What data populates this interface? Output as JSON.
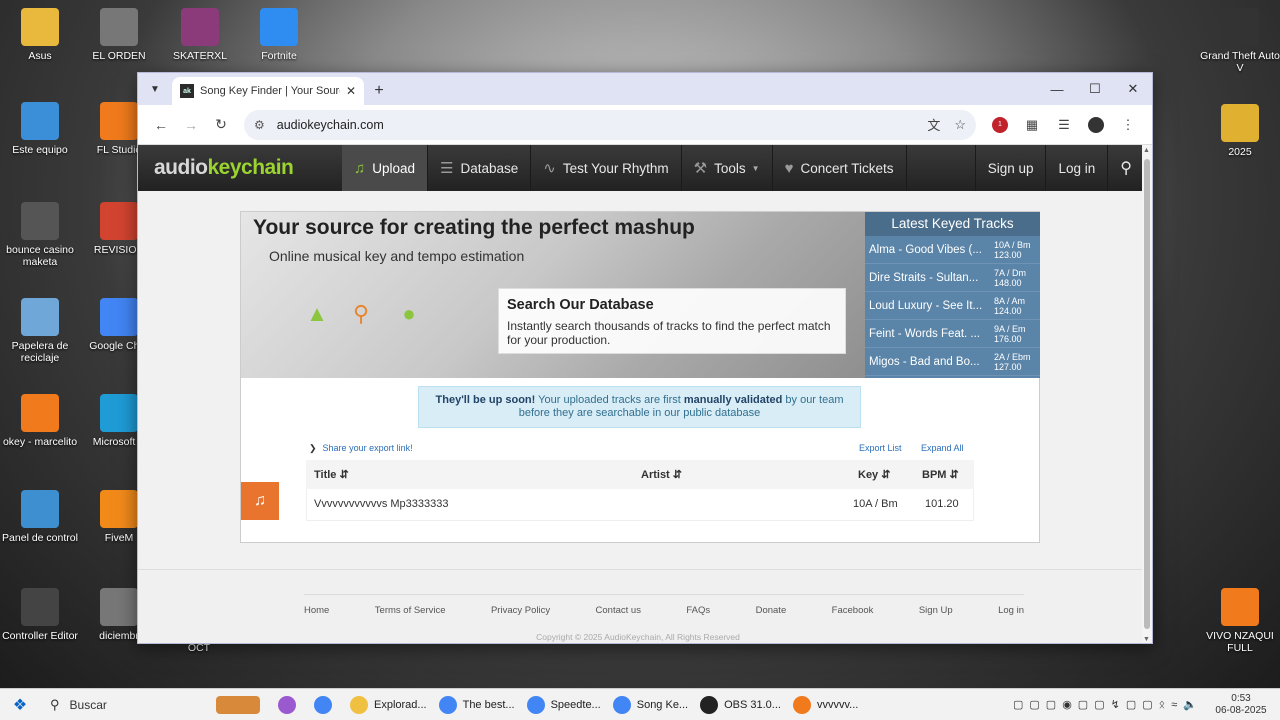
{
  "desktop_left": [
    {
      "label": "Asus",
      "icon": "folder-user-icon",
      "color": "#e8b93c"
    },
    {
      "label": "EL ORDEN",
      "icon": "file-icon",
      "color": "#777777"
    },
    {
      "label": "SKATERXL",
      "icon": "winrar-icon",
      "color": "#8b3a7a"
    },
    {
      "label": "Fortnite",
      "icon": "fortnite-icon",
      "color": "#2f8cf0"
    },
    {
      "label": "Este equipo",
      "icon": "computer-icon",
      "color": "#3b8fd8"
    },
    {
      "label": "FL Studio",
      "icon": "fl-studio-icon",
      "color": "#f07a1c"
    },
    {
      "label": "bounce casino maketa",
      "icon": "video-file-icon",
      "color": "#555555"
    },
    {
      "label": "REVISION",
      "icon": "pdf-icon",
      "color": "#d24430"
    },
    {
      "label": "Papelera de reciclaje",
      "icon": "recycle-bin-icon",
      "color": "#6fa8d8"
    },
    {
      "label": "Google Chro",
      "icon": "chrome-icon",
      "color": "#4285f4"
    },
    {
      "label": "okey - marcelito",
      "icon": "fl-studio-icon",
      "color": "#f07a1c"
    },
    {
      "label": "Microsoft E",
      "icon": "edge-icon",
      "color": "#1f9bd6"
    },
    {
      "label": "Panel de control",
      "icon": "control-panel-icon",
      "color": "#3d8fd0"
    },
    {
      "label": "FiveM",
      "icon": "fivem-icon",
      "color": "#f28a1a"
    },
    {
      "label": "Controller Editor",
      "icon": "controller-icon",
      "color": "#444444"
    },
    {
      "label": "diciembr",
      "icon": "file-icon",
      "color": "#777777"
    },
    {
      "label": "OCT",
      "icon": "",
      "color": ""
    }
  ],
  "desktop_right": [
    {
      "label": "Grand Theft Auto V",
      "icon": "gta-icon",
      "color": "#333333"
    },
    {
      "label": "2025",
      "icon": "file-icon",
      "color": "#e0b030"
    },
    {
      "label": "VIVO NZAQUI FULL",
      "icon": "fl-studio-icon",
      "color": "#f07a1c"
    }
  ],
  "browser": {
    "tab_title": "Song Key Finder | Your Source f",
    "tab_favicon": "ak",
    "url": "audiokeychain.com",
    "ext_badge": "1"
  },
  "site": {
    "logo_a": "audio",
    "logo_b": "keychain",
    "nav": [
      {
        "label": "Upload",
        "icon": "music-note-icon",
        "active": true
      },
      {
        "label": "Database",
        "icon": "database-icon",
        "active": false
      },
      {
        "label": "Test Your Rhythm",
        "icon": "waveform-icon",
        "active": false
      },
      {
        "label": "Tools",
        "icon": "wrench-icon",
        "active": false
      },
      {
        "label": "Concert Tickets",
        "icon": "ticket-icon",
        "active": false
      }
    ],
    "signup": "Sign up",
    "login": "Log in"
  },
  "hero": {
    "title": "Your source for creating the perfect mashup",
    "subtitle": "Online musical key and tempo estimation",
    "search_title": "Search Our Database",
    "search_desc": "Instantly search thousands of tracks to find the perfect match for your production."
  },
  "latest": {
    "heading": "Latest Keyed Tracks",
    "tracks": [
      {
        "name": "Alma - Good Vibes (...",
        "key": "10A / Bm",
        "bpm": "123.00"
      },
      {
        "name": "Dire Straits - Sultan...",
        "key": "7A / Dm",
        "bpm": "148.00"
      },
      {
        "name": "Loud Luxury - See It...",
        "key": "8A / Am",
        "bpm": "124.00"
      },
      {
        "name": "Feint - Words Feat. ...",
        "key": "9A / Em",
        "bpm": "176.00"
      },
      {
        "name": "Migos - Bad and Bo...",
        "key": "2A / Ebm",
        "bpm": "127.00"
      }
    ]
  },
  "notice": {
    "bold1": "They'll be up soon!",
    "text1": " Your uploaded tracks are first ",
    "bold2": "manually validated",
    "text2": " by our team before they are searchable in our public database"
  },
  "table": {
    "share": "Share your export link!",
    "export": "Export List",
    "expand": "Expand All",
    "headers": {
      "title": "Title",
      "artist": "Artist",
      "key": "Key",
      "bpm": "BPM"
    },
    "rows": [
      {
        "title": "Vvvvvvvvvvvvs Mp3333333",
        "artist": "",
        "key": "10A / Bm",
        "bpm": "101.20"
      }
    ]
  },
  "footer": {
    "links": [
      "Home",
      "Terms of Service",
      "Privacy Policy",
      "Contact us",
      "FAQs",
      "Donate",
      "Facebook",
      "Sign Up",
      "Log in"
    ],
    "copyright": "Copyright © 2025 AudioKeychain, All Rights Reserved"
  },
  "taskbar": {
    "search": "Buscar",
    "apps": [
      {
        "label": "Explorad...",
        "color": "#f0c040"
      },
      {
        "label": "The best...",
        "color": "#4285f4"
      },
      {
        "label": "Speedte...",
        "color": "#4285f4"
      },
      {
        "label": "Song Ke...",
        "color": "#4285f4"
      },
      {
        "label": "OBS 31.0...",
        "color": "#222222"
      },
      {
        "label": "vvvvvv...",
        "color": "#f07a1c"
      }
    ],
    "time": "0:53",
    "date": "06-08-2025"
  }
}
